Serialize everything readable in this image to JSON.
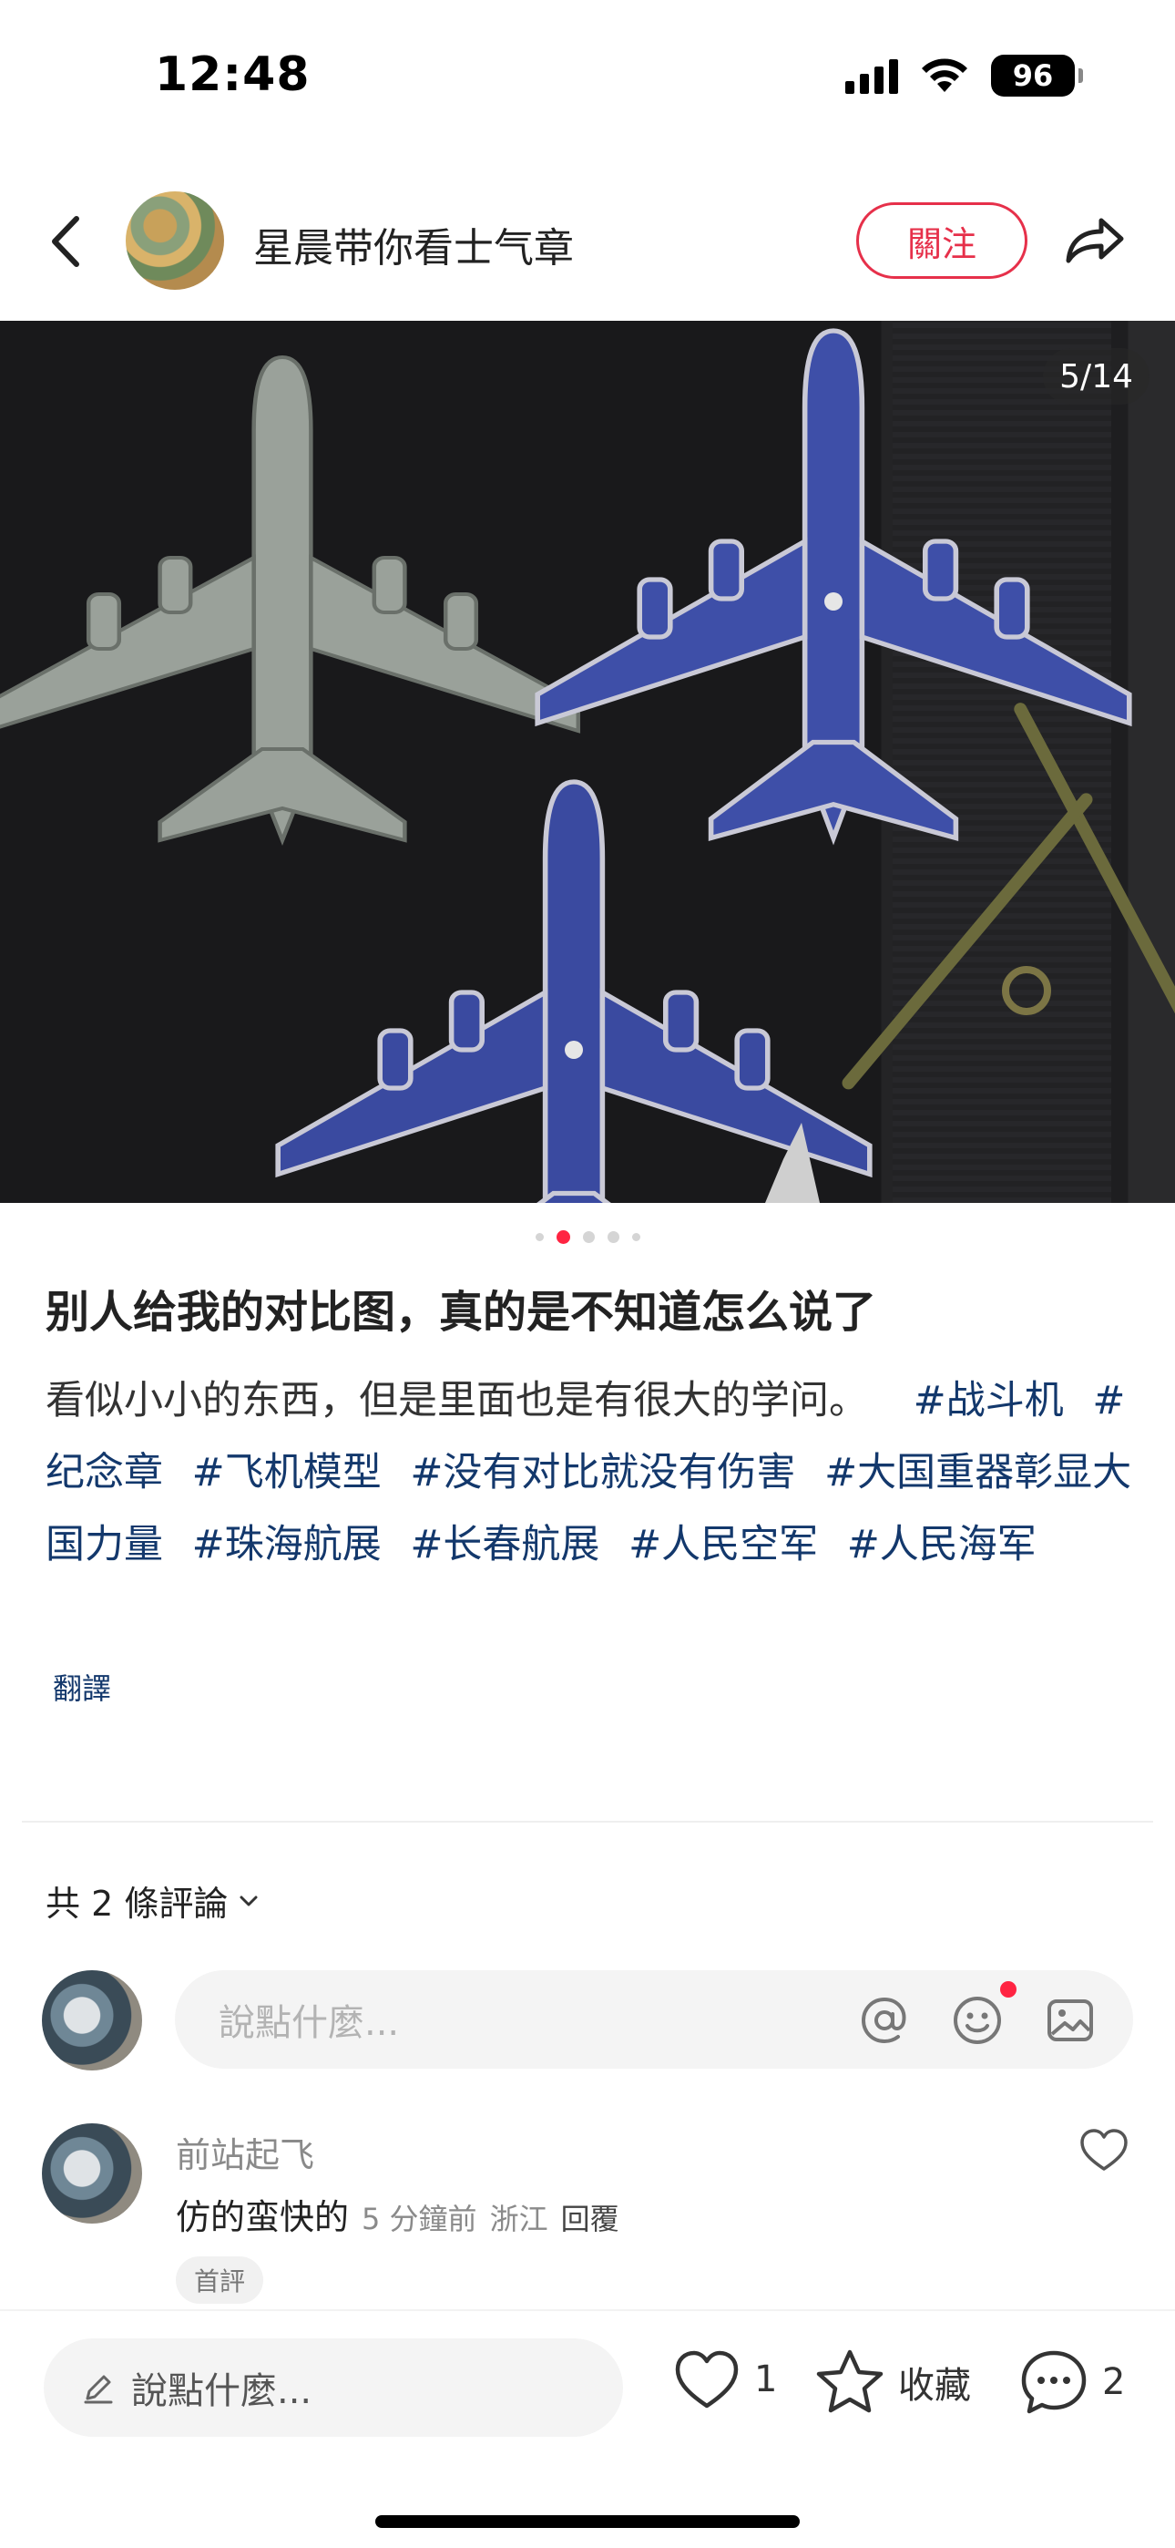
{
  "status_bar": {
    "time": "12:48",
    "battery": "96"
  },
  "header": {
    "author_name": "星晨带你看士气章",
    "follow_label": "關注"
  },
  "carousel": {
    "page_counter": "5/14",
    "current_index": 2,
    "dot_count": 5
  },
  "post": {
    "title": "别人给我的对比图，真的是不知道怎么说了",
    "body_text": "看似小小的东西，但是里面也是有很大的学问。",
    "tags": [
      "#战斗机",
      "#纪念章",
      "#飞机模型",
      "#没有对比就没有伤害",
      "#大国重器彰显大国力量",
      "#珠海航展",
      "#长春航展",
      "#人民空军",
      "#人民海军"
    ],
    "translate_label": "翻譯"
  },
  "comments": {
    "count_label": "共 2 條評論",
    "input_placeholder": "說點什麼...",
    "items": [
      {
        "user": "前站起飞",
        "text": "仿的蛮快的",
        "time": "5 分鐘前",
        "location": "浙江",
        "reply_label": "回覆",
        "badge": "首評"
      }
    ]
  },
  "bottom_bar": {
    "input_placeholder": "說點什麼...",
    "like_count": "1",
    "collect_label": "收藏",
    "comment_count": "2"
  },
  "colors": {
    "accent": "#e6304a",
    "tag": "#13386c",
    "notification_dot": "#ff2442"
  }
}
